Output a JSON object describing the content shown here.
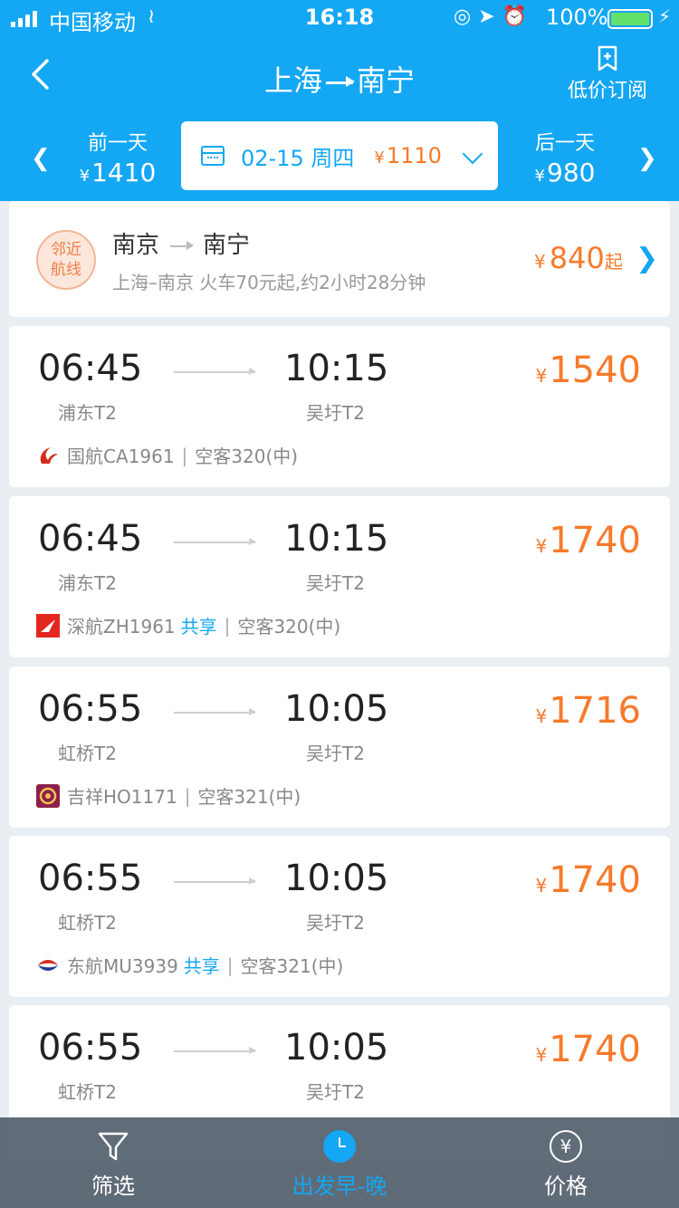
{
  "status_bar": {
    "carrier": "中国移动",
    "time": "16:18",
    "battery": "100%"
  },
  "header": {
    "from": "上海",
    "to": "南宁",
    "subscribe_label": "低价订阅"
  },
  "date_bar": {
    "prev_label": "前一天",
    "prev_price": "1410",
    "current_date": "02-15 周四",
    "current_price": "1110",
    "next_label": "后一天",
    "next_price": "980",
    "currency": "¥"
  },
  "nearby": {
    "badge_line1": "邻近",
    "badge_line2": "航线",
    "from": "南京",
    "to": "南宁",
    "description": "上海–南京 火车70元起,约2小时28分钟",
    "price": "840",
    "price_suffix": "起"
  },
  "flights": [
    {
      "dep_time": "06:45",
      "arr_time": "10:15",
      "dep_terminal": "浦东T2",
      "arr_terminal": "吴圩T2",
      "price": "1540",
      "airline_flight": "国航CA1961",
      "shared": "",
      "aircraft": "空客320(中)",
      "logo": "air-china-logo"
    },
    {
      "dep_time": "06:45",
      "arr_time": "10:15",
      "dep_terminal": "浦东T2",
      "arr_terminal": "吴圩T2",
      "price": "1740",
      "airline_flight": "深航ZH1961",
      "shared": "共享",
      "aircraft": "空客320(中)",
      "logo": "shenzhen-airlines-logo"
    },
    {
      "dep_time": "06:55",
      "arr_time": "10:05",
      "dep_terminal": "虹桥T2",
      "arr_terminal": "吴圩T2",
      "price": "1716",
      "airline_flight": "吉祥HO1171",
      "shared": "",
      "aircraft": "空客321(中)",
      "logo": "juneyao-logo"
    },
    {
      "dep_time": "06:55",
      "arr_time": "10:05",
      "dep_terminal": "虹桥T2",
      "arr_terminal": "吴圩T2",
      "price": "1740",
      "airline_flight": "东航MU3939",
      "shared": "共享",
      "aircraft": "空客321(中)",
      "logo": "china-eastern-logo"
    },
    {
      "dep_time": "06:55",
      "arr_time": "10:05",
      "dep_terminal": "虹桥T2",
      "arr_terminal": "吴圩T2",
      "price": "1740",
      "airline_flight": "",
      "shared": "",
      "aircraft": "",
      "logo": "airline-logo"
    }
  ],
  "tabbar": {
    "filter_label": "筛选",
    "time_label": "出发早-晚",
    "price_label": "价格"
  },
  "colors": {
    "brand_blue": "#14a7f3",
    "price_orange": "#f77a2b"
  }
}
